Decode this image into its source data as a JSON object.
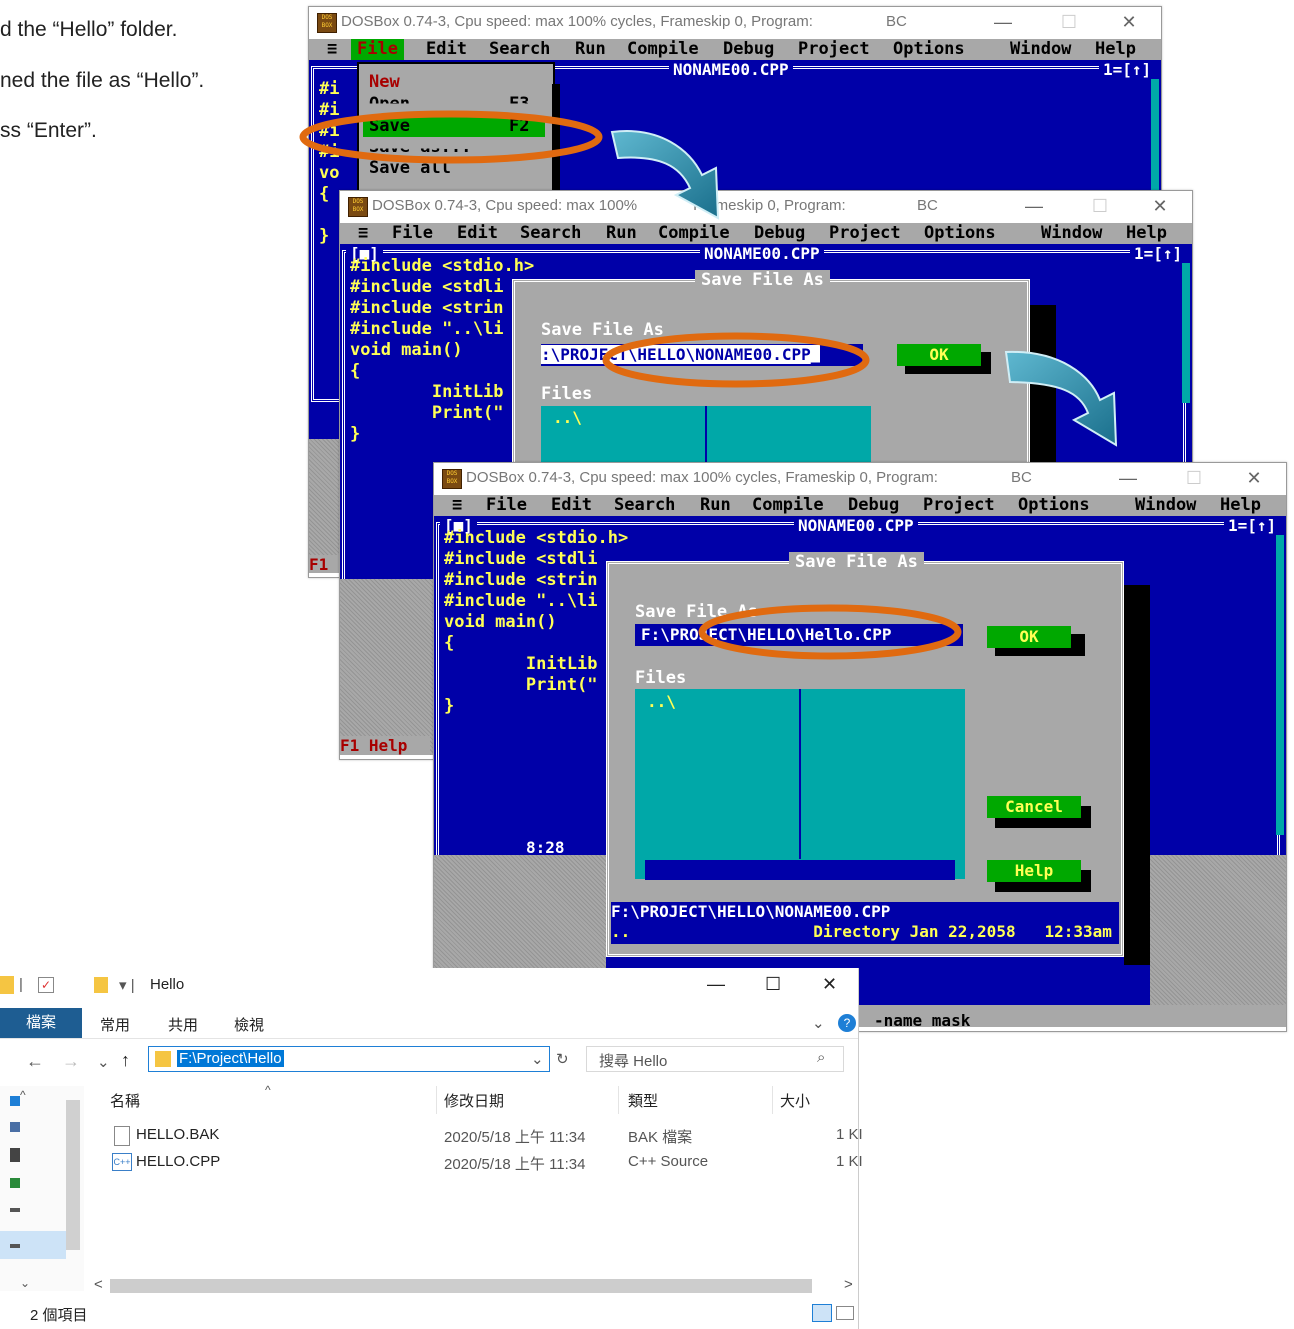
{
  "instructions": [
    "d the “Hello” folder.",
    "ned the file as “Hello”.",
    "ss “Enter”."
  ],
  "dosbox": {
    "title": "DOSBox 0.74-3, Cpu speed: max 100% cycles, Frameskip  0, Program:",
    "title_cut": "DOSBox 0.74-3, Cpu speed: max 100%",
    "title_tail": "Frameskip  0, Program:",
    "program": "BC",
    "icon_text": "DOS BOX",
    "close_glyph": "✕",
    "min_glyph": "—",
    "max_glyph": "☐"
  },
  "menubar": {
    "sys": "≡",
    "items": [
      "File",
      "Edit",
      "Search",
      "Run",
      "Compile",
      "Debug",
      "Project",
      "Options",
      "Window",
      "Help"
    ]
  },
  "editor": {
    "filename": "NONAME00.CPP",
    "window_num": "1=[↑]",
    "close_box": "[■]",
    "code_lines": [
      "#include <stdio.h>",
      "#include <stdli",
      "#include <strin",
      "#include \"..\\li",
      "void main()",
      "{",
      "        InitLib",
      "        Print(\"",
      "}"
    ],
    "cursor_pos": "8:28"
  },
  "file_menu": {
    "items": [
      "New",
      "Open...",
      "Save",
      "Save as...",
      "Save all"
    ],
    "save_key": "F2",
    "open_key": "F3"
  },
  "save_dialog": {
    "title": "Save File As",
    "label": "Save File As",
    "input_initial": ":\\PROJECT\\HELLO\\NONAME00.CPP_",
    "input_renamed": "F:\\PROJECT\\HELLO\\Hello.CPP",
    "files_label": "Files",
    "file_entry": "..\\",
    "ok": "OK",
    "cancel": "Cancel",
    "help": "Help",
    "status_path": "F:\\PROJECT\\HELLO\\NONAME00.CPP",
    "status_dir": "..                   Directory Jan 22,2058   12:33am"
  },
  "status_bar": {
    "f1": "F1",
    "f1_help": "F1 Help",
    "tail": "-name mask"
  },
  "explorer": {
    "title": "Hello",
    "ribbon_tabs": [
      "檔案",
      "常用",
      "共用",
      "檢視"
    ],
    "address": "F:\\Project\\Hello",
    "search_placeholder": "搜尋 Hello",
    "columns": [
      "名稱",
      "修改日期",
      "類型",
      "大小"
    ],
    "rows": [
      {
        "name": "HELLO.BAK",
        "date": "2020/5/18 上午 11:34",
        "type": "BAK 檔案",
        "size": "1 KI"
      },
      {
        "name": "HELLO.CPP",
        "date": "2020/5/18 上午 11:34",
        "type": "C++ Source",
        "size": "1 KI"
      }
    ],
    "status": "2 個項目"
  },
  "colors": {
    "dos_blue": "#0000a8",
    "dos_gray": "#a8a8a8",
    "dos_cyan": "#00a8a8",
    "dos_green": "#00a800",
    "dos_yellow": "#ffff55",
    "highlight_orange": "#e06a10",
    "arrow_teal": "#1f8fa8"
  }
}
